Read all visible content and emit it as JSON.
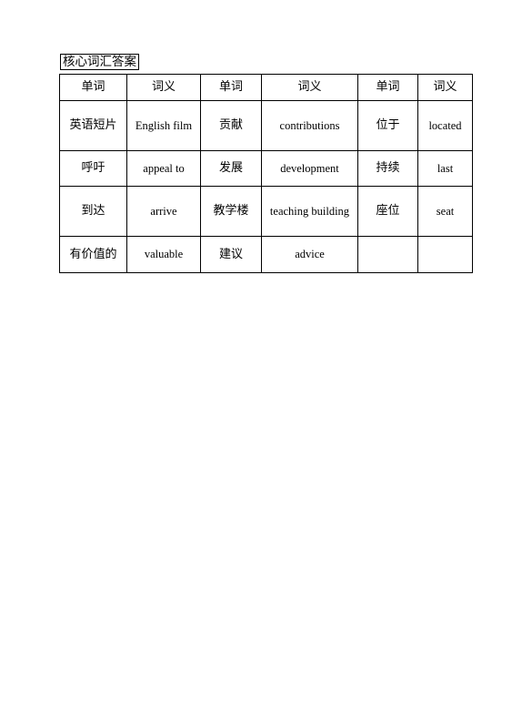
{
  "document": {
    "heading": "核心词汇答案",
    "table": {
      "headers": [
        "单词",
        "词义",
        "单词",
        "词义",
        "单词",
        "词义"
      ],
      "rows": [
        {
          "cells": [
            {
              "text": "英语短片",
              "lang": "cn"
            },
            {
              "text": "English film",
              "lang": "en"
            },
            {
              "text": "贡献",
              "lang": "cn"
            },
            {
              "text": "contributions",
              "lang": "en"
            },
            {
              "text": "位于",
              "lang": "cn"
            },
            {
              "text": "located",
              "lang": "en"
            }
          ]
        },
        {
          "cells": [
            {
              "text": "呼吁",
              "lang": "cn"
            },
            {
              "text": "appeal to",
              "lang": "en"
            },
            {
              "text": "发展",
              "lang": "cn"
            },
            {
              "text": "development",
              "lang": "en"
            },
            {
              "text": "持续",
              "lang": "cn"
            },
            {
              "text": "last",
              "lang": "en"
            }
          ]
        },
        {
          "cells": [
            {
              "text": "到达",
              "lang": "cn"
            },
            {
              "text": "arrive",
              "lang": "en"
            },
            {
              "text": "教学楼",
              "lang": "cn"
            },
            {
              "text": "teaching building",
              "lang": "en"
            },
            {
              "text": "座位",
              "lang": "cn"
            },
            {
              "text": "seat",
              "lang": "en"
            }
          ]
        },
        {
          "cells": [
            {
              "text": "有价值的",
              "lang": "cn"
            },
            {
              "text": "valuable",
              "lang": "en"
            },
            {
              "text": "建议",
              "lang": "cn"
            },
            {
              "text": "advice",
              "lang": "en"
            },
            {
              "text": "",
              "lang": "cn"
            },
            {
              "text": "",
              "lang": "en"
            }
          ]
        }
      ]
    }
  },
  "colors": {
    "text": "#000000",
    "border": "#000000",
    "background": "#ffffff"
  }
}
